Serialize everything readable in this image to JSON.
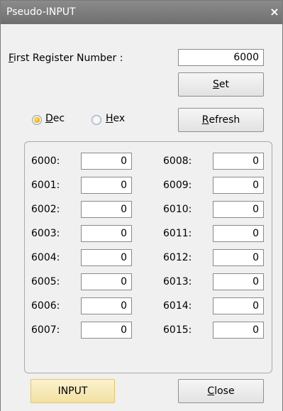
{
  "window": {
    "title": "Pseudo-INPUT",
    "close_glyph": "×"
  },
  "first_register": {
    "label_prefix": "F",
    "label_rest": "irst Register Number :",
    "value": "6000"
  },
  "buttons": {
    "set": {
      "u": "S",
      "rest": "et"
    },
    "refresh": {
      "u": "R",
      "rest": "efresh"
    },
    "input": "INPUT",
    "close": {
      "u": "C",
      "rest": "lose"
    }
  },
  "radios": {
    "dec": {
      "u": "D",
      "rest": "ec",
      "checked": true
    },
    "hex": {
      "u": "H",
      "rest": "ex",
      "checked": false
    }
  },
  "registers": {
    "left": [
      {
        "label": "6000:",
        "value": "0"
      },
      {
        "label": "6001:",
        "value": "0"
      },
      {
        "label": "6002:",
        "value": "0"
      },
      {
        "label": "6003:",
        "value": "0"
      },
      {
        "label": "6004:",
        "value": "0"
      },
      {
        "label": "6005:",
        "value": "0"
      },
      {
        "label": "6006:",
        "value": "0"
      },
      {
        "label": "6007:",
        "value": "0"
      }
    ],
    "right": [
      {
        "label": "6008:",
        "value": "0"
      },
      {
        "label": "6009:",
        "value": "0"
      },
      {
        "label": "6010:",
        "value": "0"
      },
      {
        "label": "6011:",
        "value": "0"
      },
      {
        "label": "6012:",
        "value": "0"
      },
      {
        "label": "6013:",
        "value": "0"
      },
      {
        "label": "6014:",
        "value": "0"
      },
      {
        "label": "6015:",
        "value": "0"
      }
    ]
  },
  "colors": {
    "titlebar": "#7b7b7b",
    "dialog_bg": "#f0f0f0",
    "focused_button": "#f6e7b4",
    "radio_selected": "#ffb200"
  }
}
